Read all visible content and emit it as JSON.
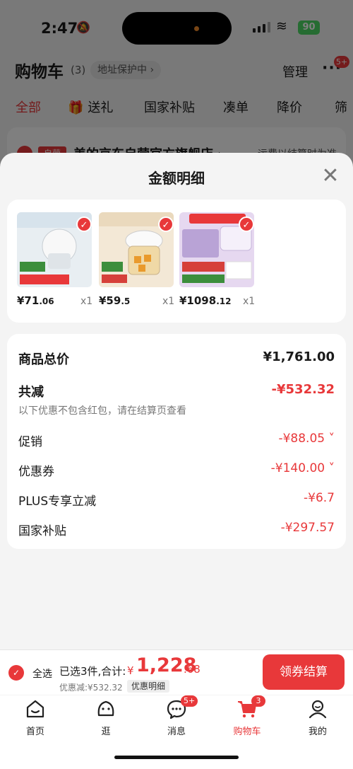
{
  "status_bar": {
    "time": "2:47",
    "battery": "90"
  },
  "cart": {
    "title": "购物车",
    "count": "(3)",
    "address_pill": "地址保护中 ›",
    "manage": "管理",
    "more_badge": "5+",
    "filters": [
      "全部",
      "送礼",
      "国家补贴",
      "凑单",
      "降价",
      "筛"
    ],
    "store_tag": "自营",
    "store_name": "美的京东自营官方旗舰店 ›",
    "store_shipping": "运费以结算时为准"
  },
  "sheet": {
    "title": "金额明细",
    "products": [
      {
        "price_int": "¥71",
        "price_dec": ".06",
        "qty": "x1",
        "color": "#e8eef2"
      },
      {
        "price_int": "¥59",
        "price_dec": ".5",
        "qty": "x1",
        "color": "#f3e8d6"
      },
      {
        "price_int": "¥1098",
        "price_dec": ".12",
        "qty": "x1",
        "color": "#e6d8f0"
      }
    ],
    "details": {
      "total_label": "商品总价",
      "total_value": "¥1,761.00",
      "reduced_label": "共减",
      "reduced_value": "-¥532.32",
      "reduced_note": "以下优惠不包含红包，请在结算页查看",
      "promo_label": "促销",
      "promo_value": "-¥88.05 ˅",
      "coupon_label": "优惠券",
      "coupon_value": "-¥140.00 ˅",
      "plus_label": "PLUS专享立减",
      "plus_value": "-¥6.7",
      "subsidy_label": "国家补贴",
      "subsidy_value": "-¥297.57"
    }
  },
  "checkout": {
    "select_all": "全选",
    "selected_text": "已选3件,合计:",
    "currency": "¥",
    "total_int": "1,228",
    "total_dec": ".68",
    "discount_note": "优惠减:¥532.32",
    "discount_detail": "优惠明细",
    "pay_button": "领券结算"
  },
  "tabbar": {
    "items": [
      {
        "label": "首页",
        "icon": "home-icon"
      },
      {
        "label": "逛",
        "icon": "discover-icon"
      },
      {
        "label": "消息",
        "icon": "message-icon",
        "badge": "5+"
      },
      {
        "label": "购物车",
        "icon": "cart-icon",
        "badge": "3"
      },
      {
        "label": "我的",
        "icon": "profile-icon"
      }
    ]
  },
  "colors": {
    "accent": "#e8383a"
  }
}
